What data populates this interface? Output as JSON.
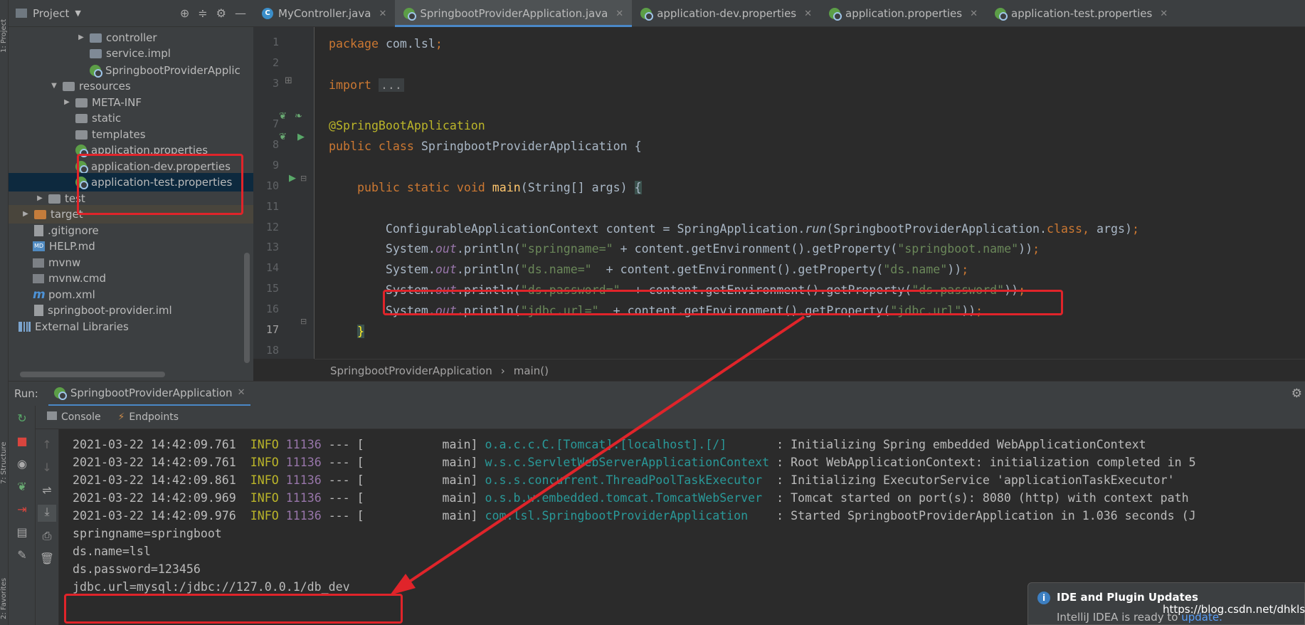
{
  "left_strip": {
    "project_label": "1: Project",
    "structure_label": "7: Structure",
    "favorites_label": "2: Favorites"
  },
  "project_panel": {
    "title": "Project",
    "tree": [
      {
        "label": "controller",
        "icon": "package-folder",
        "expanded": false
      },
      {
        "label": "service.impl",
        "icon": "package-folder"
      },
      {
        "label": "SpringbootProviderApplic",
        "icon": "spring-class"
      },
      {
        "label": "resources",
        "icon": "resources-folder",
        "expanded": true
      },
      {
        "label": "META-INF",
        "icon": "folder",
        "expanded": false
      },
      {
        "label": "static",
        "icon": "folder"
      },
      {
        "label": "templates",
        "icon": "folder"
      },
      {
        "label": "application.properties",
        "icon": "spring-properties"
      },
      {
        "label": "application-dev.properties",
        "icon": "spring-properties"
      },
      {
        "label": "application-test.properties",
        "icon": "spring-properties",
        "selected": true
      },
      {
        "label": "test",
        "icon": "folder",
        "expanded": false
      },
      {
        "label": "target",
        "icon": "orange-folder",
        "expanded": false
      },
      {
        "label": ".gitignore",
        "icon": "file"
      },
      {
        "label": "HELP.md",
        "icon": "markdown-file"
      },
      {
        "label": "mvnw",
        "icon": "file"
      },
      {
        "label": "mvnw.cmd",
        "icon": "file"
      },
      {
        "label": "pom.xml",
        "icon": "maven-file"
      },
      {
        "label": "springboot-provider.iml",
        "icon": "file"
      },
      {
        "label": "External Libraries",
        "icon": "library"
      }
    ]
  },
  "editor_tabs": [
    {
      "label": "MyController.java",
      "icon": "java-class-icon",
      "active": false
    },
    {
      "label": "SpringbootProviderApplication.java",
      "icon": "spring-class-icon",
      "active": true
    },
    {
      "label": "application-dev.properties",
      "icon": "spring-properties-icon",
      "active": false
    },
    {
      "label": "application.properties",
      "icon": "spring-properties-icon",
      "active": false
    },
    {
      "label": "application-test.properties",
      "icon": "spring-properties-icon",
      "active": false
    }
  ],
  "editor": {
    "line_numbers": [
      "1",
      "2",
      "3",
      "7",
      "8",
      "9",
      "10",
      "11",
      "12",
      "13",
      "14",
      "15",
      "16",
      "17",
      "18"
    ],
    "current_line": "17",
    "lines": [
      "package com.lsl;",
      "",
      "import ...",
      "@SpringBootApplication",
      "public class SpringbootProviderApplication {",
      "",
      "    public static void main(String[] args) {",
      "",
      "        ConfigurableApplicationContext content = SpringApplication.run(SpringbootProviderApplication.class, args);",
      "        System.out.println(\"springname=\" + content.getEnvironment().getProperty(\"springboot.name\"));",
      "        System.out.println(\"ds.name=\"  + content.getEnvironment().getProperty(\"ds.name\"));",
      "        System.out.println(\"ds.password=\"  + content.getEnvironment().getProperty(\"ds.password\"));",
      "        System.out.println(\"jdbc.url=\"  + content.getEnvironment().getProperty(\"jdbc.url\"));",
      "    }",
      ""
    ]
  },
  "breadcrumb": {
    "class_name": "SpringbootProviderApplication",
    "separator": "›",
    "method": "main()"
  },
  "run_panel": {
    "label": "Run:",
    "config": "SpringbootProviderApplication",
    "tabs": [
      "Console",
      "Endpoints"
    ]
  },
  "console": {
    "log_lines": [
      {
        "ts": "2021-03-22 14:42:09.761",
        "level": "INFO",
        "pid": "11136",
        "sep": "---",
        "thread": "[           main]",
        "logger": "o.a.c.c.C.[Tomcat].[localhost].[/]      ",
        "msg": ": Initializing Spring embedded WebApplicationContext"
      },
      {
        "ts": "2021-03-22 14:42:09.761",
        "level": "INFO",
        "pid": "11136",
        "sep": "---",
        "thread": "[           main]",
        "logger": "w.s.c.ServletWebServerApplicationContext",
        "msg": ": Root WebApplicationContext: initialization completed in 5"
      },
      {
        "ts": "2021-03-22 14:42:09.861",
        "level": "INFO",
        "pid": "11136",
        "sep": "---",
        "thread": "[           main]",
        "logger": "o.s.s.concurrent.ThreadPoolTaskExecutor ",
        "msg": ": Initializing ExecutorService 'applicationTaskExecutor'"
      },
      {
        "ts": "2021-03-22 14:42:09.969",
        "level": "INFO",
        "pid": "11136",
        "sep": "---",
        "thread": "[           main]",
        "logger": "o.s.b.w.embedded.tomcat.TomcatWebServer ",
        "msg": ": Tomcat started on port(s): 8080 (http) with context path"
      },
      {
        "ts": "2021-03-22 14:42:09.976",
        "level": "INFO",
        "pid": "11136",
        "sep": "---",
        "thread": "[           main]",
        "logger": "com.lsl.SpringbootProviderApplication   ",
        "msg": ": Started SpringbootProviderApplication in 1.036 seconds (J"
      }
    ],
    "output_lines": [
      "springname=springboot",
      "ds.name=lsl",
      "ds.password=123456",
      "jdbc.url=mysql:/jdbc://127.0.0.1/db_dev"
    ]
  },
  "notification": {
    "title": "IDE and Plugin Updates",
    "body": "IntelliJ IDEA is ready to ",
    "link": "update."
  },
  "watermark": "https://blog.csdn.net/dhklsl",
  "colors": {
    "annotation_red": "#e0242a",
    "accent": "#4a88c7",
    "selection": "#0d293e"
  }
}
